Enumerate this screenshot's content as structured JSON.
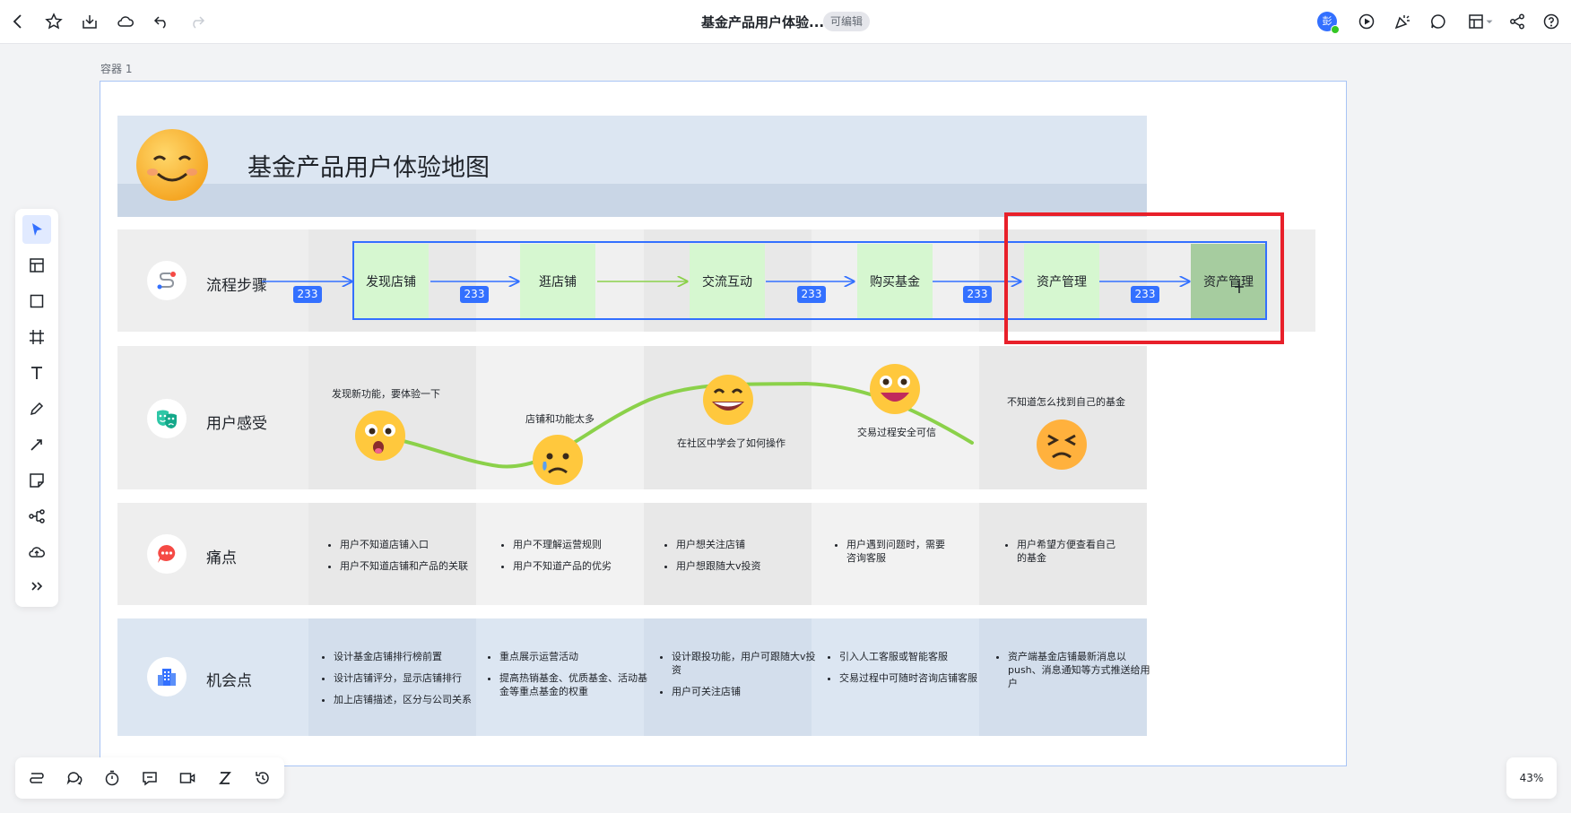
{
  "header": {
    "title": "基金产品用户体验...",
    "badge": "可编辑",
    "avatar_text": "彭"
  },
  "canvas": {
    "container_label": "容器 1",
    "zoom": "43%"
  },
  "map": {
    "title": "基金产品用户体验地图",
    "rows": {
      "steps_label": "流程步骤",
      "feel_label": "用户感受",
      "pain_label": "痛点",
      "opp_label": "机会点"
    },
    "steps": [
      "发现店铺",
      "逛店铺",
      "交流互动",
      "购买基金",
      "资产管理",
      "资产管理"
    ],
    "badges": [
      "233",
      "233",
      "233",
      "233",
      "233"
    ],
    "feelings": [
      "发现新功能，要体验一下",
      "店铺和功能太多",
      "在社区中学会了如何操作",
      "交易过程安全可信",
      "不知道怎么找到自己的基金"
    ],
    "pains": [
      [
        "用户不知道店铺入口",
        "用户不知道店铺和产品的关联"
      ],
      [
        "用户不理解运营规则",
        "用户不知道产品的优劣"
      ],
      [
        "用户想关注店铺",
        "用户想跟随大v投资"
      ],
      [
        "用户遇到问题时，需要咨询客服"
      ],
      [
        "用户希望方便查看自己的基金"
      ]
    ],
    "opportunities": [
      [
        "设计基金店铺排行榜前置",
        "设计店铺评分，显示店铺排行",
        "加上店铺描述，区分与公司关系"
      ],
      [
        "重点展示运营活动",
        "提高热销基金、优质基金、活动基金等重点基金的权重"
      ],
      [
        "设计跟投功能，用户可跟随大v投资",
        "用户可关注店铺"
      ],
      [
        "引入人工客服或智能客服",
        "交易过程中可随时咨询店铺客服"
      ],
      [
        "资产端基金店铺最新消息以push、消息通知等方式推送给用户"
      ]
    ]
  },
  "colors": {
    "accent": "#3370ff",
    "highlight": "#e8202a",
    "step_fill": "#d6f7d0",
    "curve": "#8bd14a"
  }
}
